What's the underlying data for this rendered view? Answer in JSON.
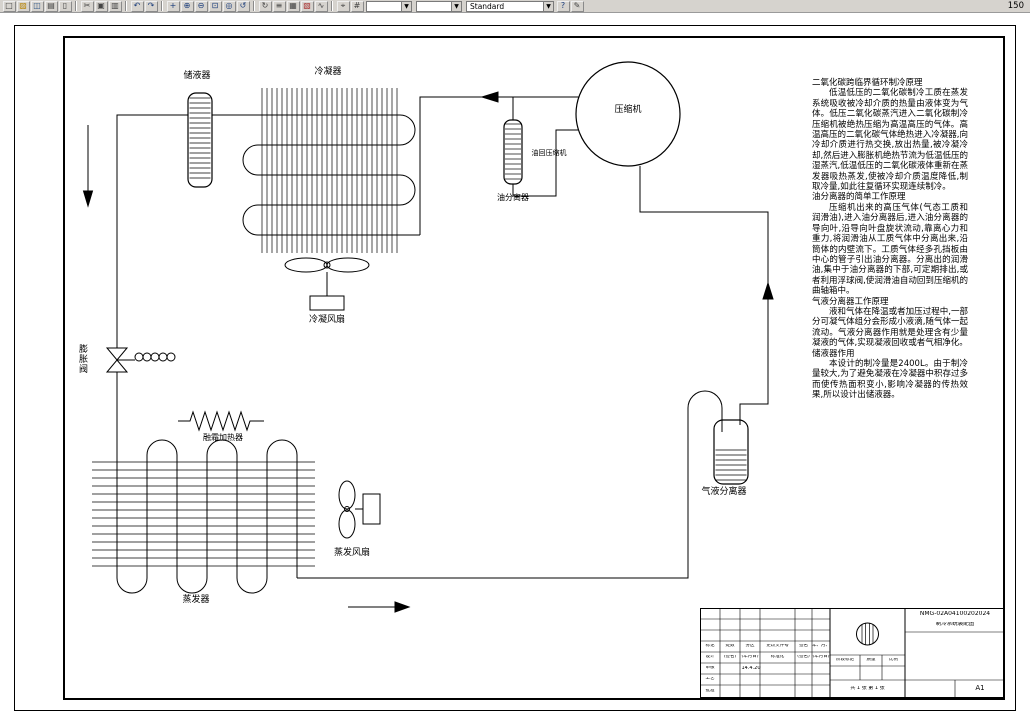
{
  "toolbar": {
    "icons": [
      {
        "name": "new-file",
        "glyph": "□",
        "color": "#444444"
      },
      {
        "name": "open-file",
        "glyph": "▨",
        "color": "#b8860b"
      },
      {
        "name": "save-file",
        "glyph": "◫",
        "color": "#335b8c"
      },
      {
        "name": "print",
        "glyph": "▤",
        "color": "#444444"
      },
      {
        "name": "print-preview",
        "glyph": "▯",
        "color": "#444444"
      },
      {
        "sep": true
      },
      {
        "name": "cut",
        "glyph": "✂",
        "color": "#444444"
      },
      {
        "name": "copy",
        "glyph": "▣",
        "color": "#444444"
      },
      {
        "name": "paste",
        "glyph": "▥",
        "color": "#444444"
      },
      {
        "sep": true
      },
      {
        "name": "undo",
        "glyph": "↶",
        "color": "#1a3d7c"
      },
      {
        "name": "redo",
        "glyph": "↷",
        "color": "#1a3d7c"
      },
      {
        "sep": true
      },
      {
        "name": "pan",
        "glyph": "+",
        "color": "#1a3d7c"
      },
      {
        "name": "zoom-in",
        "glyph": "⊕",
        "color": "#1a3d7c"
      },
      {
        "name": "zoom-out",
        "glyph": "⊖",
        "color": "#1a3d7c"
      },
      {
        "name": "zoom-window",
        "glyph": "⊡",
        "color": "#1a3d7c"
      },
      {
        "name": "zoom-extents",
        "glyph": "◎",
        "color": "#1a3d7c"
      },
      {
        "name": "zoom-previous",
        "glyph": "↺",
        "color": "#1a3d7c"
      },
      {
        "sep": true
      },
      {
        "name": "redraw",
        "glyph": "↻",
        "color": "#444444"
      },
      {
        "name": "layers",
        "glyph": "≡",
        "color": "#444444"
      },
      {
        "name": "layer-properties",
        "glyph": "▦",
        "color": "#444444"
      },
      {
        "name": "color-control",
        "glyph": "▧",
        "color": "#aa3333"
      },
      {
        "name": "linetype",
        "glyph": "∿",
        "color": "#444444"
      },
      {
        "sep": true
      },
      {
        "name": "object-snap",
        "glyph": "⌖",
        "color": "#444444"
      },
      {
        "name": "grid",
        "glyph": "#",
        "color": "#444444"
      }
    ],
    "right_icons": [
      {
        "name": "help",
        "glyph": "?",
        "color": "#1a3d7c"
      },
      {
        "name": "draw-tool",
        "glyph": "✎",
        "color": "#444444"
      }
    ],
    "layer_combo_value": "",
    "color_combo_value": "",
    "style_combo_value": "Standard",
    "zoom_value": "150"
  },
  "schematic": {
    "labels": {
      "receiver": "储液器",
      "condenser": "冷凝器",
      "compressor": "压缩机",
      "oil_return": "油回压缩机",
      "oil_separator": "油分离器",
      "condenser_fan": "冷凝风扇",
      "expansion_valve": "膨胀阀",
      "defrost_heater": "融霜加热器",
      "evaporator_fan": "蒸发风扇",
      "evaporator": "蒸发器",
      "gas_liquid_separator": "气液分离器"
    }
  },
  "notes": {
    "sections": [
      {
        "heading": "二氧化碳跨临界循环制冷原理",
        "body": "低温低压的二氧化碳制冷工质在蒸发系统吸收被冷却介质的热量由液体变为气体。低压二氧化碳蒸汽进入二氧化碳制冷压缩机被绝热压缩为高温高压的气体。高温高压的二氧化碳气体绝热进入冷凝器,向冷却介质进行热交换,放出热量,被冷凝冷却,然后进入膨胀机绝热节流为低温低压的湿蒸汽,低温低压的二氧化碳液体重新在蒸发器吸热蒸发,使被冷却介质温度降低,制取冷量,如此往复循环实现连续制冷。"
      },
      {
        "heading": "油分离器的简单工作原理",
        "body": "压缩机出来的高压气体(气态工质和润滑油),进入油分离器后,进入油分离器的导向叶,沿导向叶盘旋状流动,靠离心力和重力,将润滑油从工质气体中分离出来,沿筒体的内壁流下。工质气体经多孔挡板由中心的管子引出油分离器。分离出的润滑油,集中于油分离器的下部,可定期排出,或者利用浮球阀,使润滑油自动回到压缩机的曲轴箱中。"
      },
      {
        "heading": "气液分离器工作原理",
        "body": "液和气体在降温或者加压过程中,一部分可凝气体组分会形成小液滴,随气体一起流动。气液分离器作用就是处理含有少量凝液的气体,实现凝液回收或者气相净化。"
      },
      {
        "heading": "储液器作用",
        "body": "本设计的制冷量是2400L。由于制冷量较大,为了避免凝液在冷凝器中积存过多而使传热面积变小,影响冷凝器的传热效果,所以设计出储液器。"
      }
    ]
  },
  "titleblock": {
    "col_mark": "标记",
    "col_count": "处数",
    "col_zone": "分区",
    "col_change_file": "更改文件号",
    "col_sign": "签名",
    "col_date": "年、月、日",
    "row_design": "设计",
    "sign_hint": "(签名)",
    "date_hint": "(年月日)",
    "row_standard": "标准化",
    "row_review": "审核",
    "row_craft": "工艺",
    "row_approve": "批准",
    "date_value": "14.4.20",
    "stage_mark": "阶段标记",
    "weight": "质量",
    "scale": "比例",
    "sheet_total": "共 1 张 第 1 张",
    "drawing_no": "NMG-02A04100202024",
    "drawing_name": "制冷系统装配图",
    "paper_size": "A1"
  }
}
